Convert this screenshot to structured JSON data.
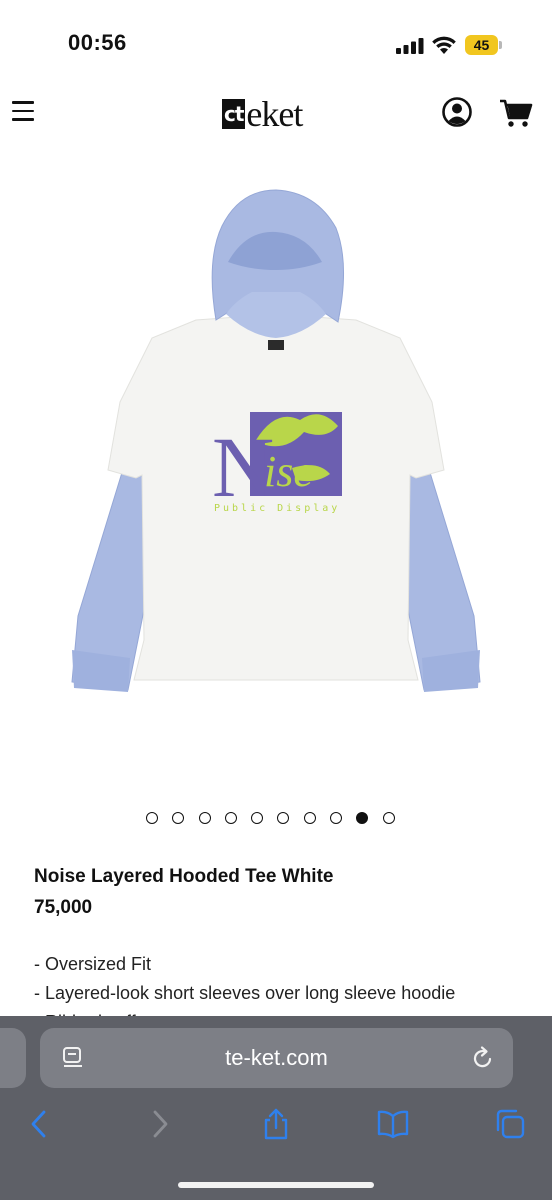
{
  "status_bar": {
    "time": "00:56",
    "battery": "45"
  },
  "header": {
    "logo_box": "ct",
    "logo_text": "eket"
  },
  "carousel": {
    "total": 10,
    "active_index": 8
  },
  "product": {
    "name": "Noise Layered Hooded Tee White",
    "price": "75,000",
    "description": [
      "- Oversized Fit",
      "- Layered-look short sleeves over long sleeve hoodie",
      "- Ribbed cuffs"
    ],
    "print_text": {
      "letter_n": "N",
      "word_ise": "ise",
      "tagline": "Public Display"
    }
  },
  "browser": {
    "url": "te-ket.com"
  },
  "colors": {
    "hoodie_blue": "#a9b9e2",
    "body_white": "#f4f4f2",
    "print_purple": "#6c5fb0",
    "print_green": "#b9d64a",
    "safari_bar": "#5e6067",
    "safari_icon": "#2f80ed"
  },
  "icons": {
    "menu": "hamburger-icon",
    "account": "user-circle-icon",
    "cart": "shopping-cart-icon",
    "reader": "page-menu-icon",
    "reload": "reload-icon",
    "back": "chevron-left-icon",
    "forward": "chevron-right-icon",
    "share": "share-icon",
    "bookmarks": "book-icon",
    "tabs": "tabs-icon"
  }
}
